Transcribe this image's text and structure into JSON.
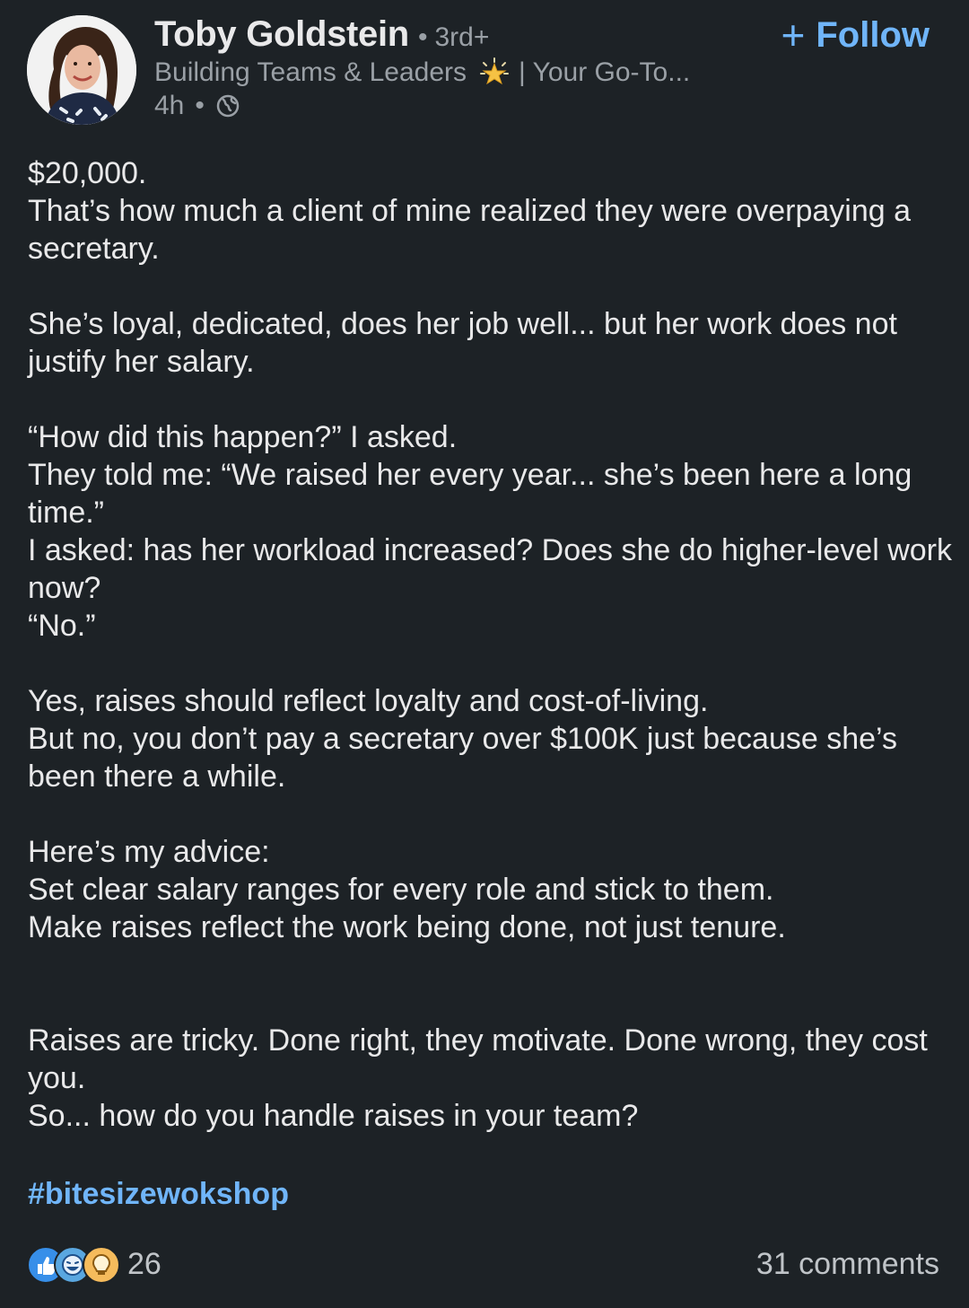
{
  "author": {
    "name": "Toby Goldstein",
    "degree_separator": "•",
    "degree": "3rd+",
    "headline_part1": "Building Teams & Leaders",
    "headline_part2": "| Your Go-To...",
    "time": "4h",
    "time_separator": "•",
    "visibility_icon": "globe-icon",
    "headline_icon": "star-icon"
  },
  "follow": {
    "plus": "+",
    "label": "Follow"
  },
  "post": {
    "lines": [
      "$20,000.",
      "That’s how much a client of mine realized they were overpaying a secretary.",
      "She’s loyal, dedicated, does her job well... but her work does not justify her salary.",
      "“How did this happen?” I asked.",
      "They told me: “We raised her every year... she’s been here a long time.”",
      "I asked: has her workload increased? Does she do higher-level work now?",
      "“No.”",
      "Yes, raises should reflect loyalty and cost-of-living.",
      "But no, you don’t pay a secretary over $100K just because she’s been there a while.",
      "Here’s my advice:",
      "Set clear salary ranges for every role and stick to them.",
      "Make raises reflect the work being done, not just tenure.",
      "Raises are tricky. Done right, they motivate. Done wrong, they cost you.",
      "So... how do you handle raises in your team?"
    ],
    "hashtag": "#bitesizewokshop"
  },
  "social": {
    "reaction_icons": [
      "like-icon",
      "funny-icon",
      "insightful-icon"
    ],
    "reaction_count": "26",
    "comments": "31 comments"
  },
  "colors": {
    "background": "#1d2226",
    "text": "#e9e9ea",
    "muted": "#9aa0a6",
    "accent": "#70b5f9"
  }
}
